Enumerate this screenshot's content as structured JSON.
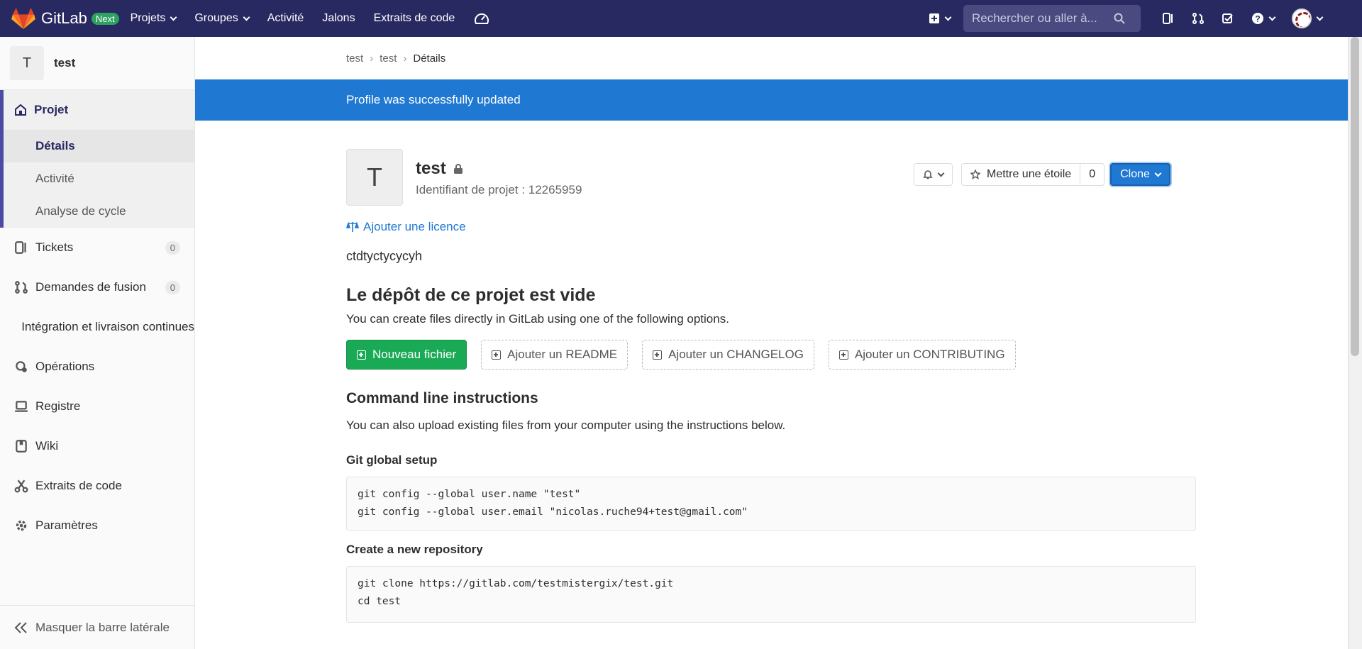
{
  "topbar": {
    "brand": "GitLab",
    "badge": "Next",
    "nav": [
      {
        "label": "Projets",
        "dropdown": true
      },
      {
        "label": "Groupes",
        "dropdown": true
      },
      {
        "label": "Activité",
        "dropdown": false
      },
      {
        "label": "Jalons",
        "dropdown": false
      },
      {
        "label": "Extraits de code",
        "dropdown": false
      }
    ],
    "search_placeholder": "Rechercher ou aller à..."
  },
  "sidebar": {
    "project_initial": "T",
    "project_name": "test",
    "project_section": "Projet",
    "project_sub": [
      "Détails",
      "Activité",
      "Analyse de cycle"
    ],
    "items": [
      {
        "label": "Tickets",
        "icon": "issues-icon",
        "count": "0"
      },
      {
        "label": "Demandes de fusion",
        "icon": "merge-request-icon",
        "count": "0"
      },
      {
        "label": "Intégration et livraison continues",
        "icon": "rocket-icon"
      },
      {
        "label": "Opérations",
        "icon": "cloud-gear-icon"
      },
      {
        "label": "Registre",
        "icon": "registry-icon"
      },
      {
        "label": "Wiki",
        "icon": "book-icon"
      },
      {
        "label": "Extraits de code",
        "icon": "scissors-icon"
      },
      {
        "label": "Paramètres",
        "icon": "gear-icon"
      }
    ],
    "collapse_label": "Masquer la barre latérale"
  },
  "breadcrumb": [
    "test",
    "test",
    "Détails"
  ],
  "flash": "Profile was successfully updated",
  "project": {
    "initial": "T",
    "name": "test",
    "id_text": "Identifiant de projet : 12265959",
    "star_label": "Mettre une étoile",
    "star_count": "0",
    "clone_label": "Clone",
    "licence_label": "Ajouter une licence",
    "description": "ctdtyctycycyh"
  },
  "empty": {
    "title": "Le dépôt de ce projet est vide",
    "subtitle": "You can create files directly in GitLab using one of the following options.",
    "new_file": "Nouveau fichier",
    "add_readme": "Ajouter un README",
    "add_changelog": "Ajouter un CHANGELOG",
    "add_contributing": "Ajouter un CONTRIBUTING"
  },
  "cli": {
    "title": "Command line instructions",
    "subtitle": "You can also upload existing files from your computer using the instructions below.",
    "global_setup_title": "Git global setup",
    "global_setup_lines": [
      "git config --global user.name \"test\"",
      "git config --global user.email \"nicolas.ruche94+test@gmail.com\""
    ],
    "new_repo_title": "Create a new repository",
    "new_repo_lines": [
      "git clone https://gitlab.com/testmistergix/test.git",
      "cd test"
    ]
  },
  "colors": {
    "topbar": "#292961",
    "flash": "#1f78d1",
    "new_file_button": "#1aaa55"
  }
}
